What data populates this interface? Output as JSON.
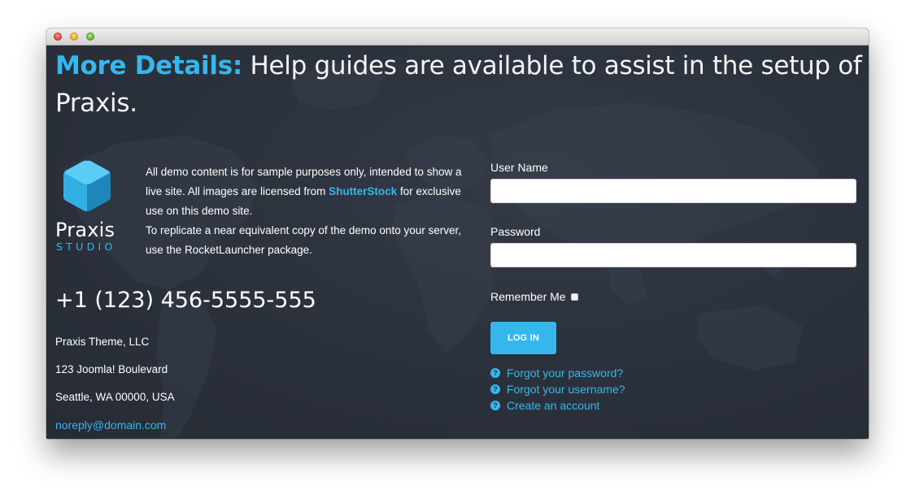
{
  "headline": {
    "accent": "More Details:",
    "text": " Help guides are available to assist in the setup of Praxis."
  },
  "logo": {
    "word": "Praxis",
    "sub": "STUDIO",
    "icon": "cube-icon"
  },
  "intro": {
    "text_part1": "All demo content is for sample purposes only, intended to show a live site. All images are licensed from ",
    "link": "ShutterStock",
    "text_part2": " for exclusive use on this demo site.",
    "paragraph2": "To replicate a near equivalent copy of the demo onto your server, use the RocketLauncher package."
  },
  "contact": {
    "phone": "+1 (123) 456-5555-555",
    "company": "Praxis Theme, LLC",
    "street": "123 Joomla! Boulevard",
    "city": "Seattle, WA 00000, USA",
    "email": "noreply@domain.com"
  },
  "login": {
    "username_label": "User Name",
    "username_value": "",
    "password_label": "Password",
    "password_value": "",
    "remember_label": "Remember Me",
    "remember_checked": false,
    "submit_label": "LOG IN",
    "links": [
      {
        "icon": "question-circle-icon",
        "label": "Forgot your password?"
      },
      {
        "icon": "question-circle-icon",
        "label": "Forgot your username?"
      },
      {
        "icon": "question-circle-icon",
        "label": "Create an account"
      }
    ]
  },
  "colors": {
    "accent": "#35b7ee",
    "background": "#2a303a",
    "text": "#ffffff"
  }
}
